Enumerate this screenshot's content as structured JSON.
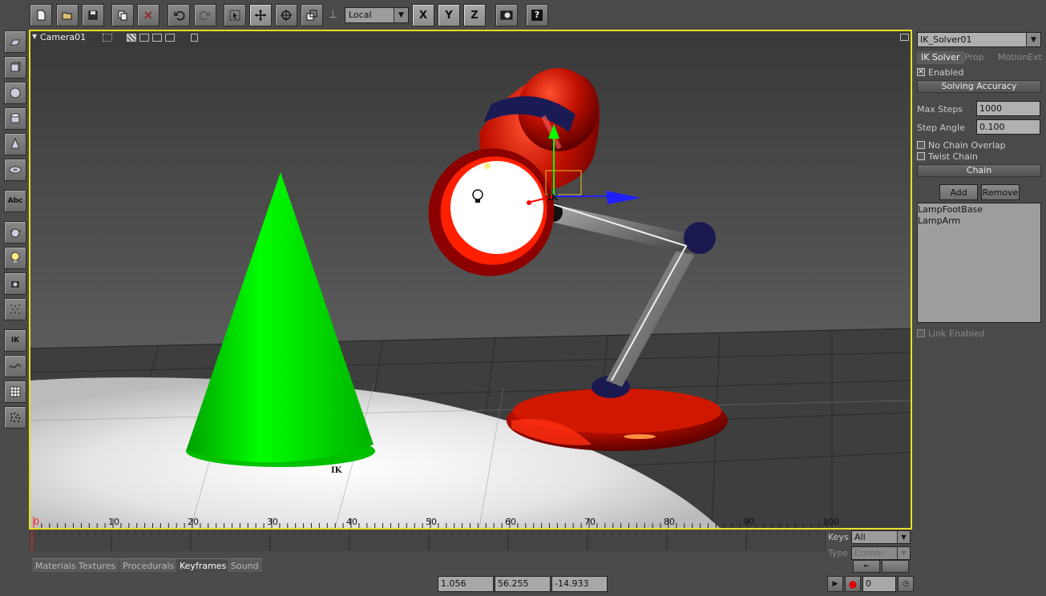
{
  "toolbar": {
    "buttons": [
      {
        "name": "new-file-icon",
        "glyph": "🗋"
      },
      {
        "name": "open-folder-icon",
        "glyph": "📂"
      },
      {
        "name": "save-icon",
        "glyph": "💾"
      },
      {
        "name": "copy-icon",
        "glyph": "⧉"
      },
      {
        "name": "delete-icon",
        "glyph": "✕"
      },
      {
        "name": "undo-icon",
        "glyph": "↶"
      },
      {
        "name": "redo-icon",
        "glyph": "↷"
      },
      {
        "name": "select-tool-icon",
        "glyph": "⬚"
      },
      {
        "name": "move-tool-icon",
        "glyph": "✥"
      },
      {
        "name": "rotate-tool-icon",
        "glyph": "⊕"
      },
      {
        "name": "scale-tool-icon",
        "glyph": "⧈"
      }
    ],
    "space_select": "Local",
    "axis_x": "X",
    "axis_y": "Y",
    "axis_z": "Z",
    "help": "?"
  },
  "left_tools": [
    {
      "name": "plane-icon",
      "label": ""
    },
    {
      "name": "cube-icon",
      "label": ""
    },
    {
      "name": "sphere-icon",
      "label": ""
    },
    {
      "name": "cylinder-icon",
      "label": ""
    },
    {
      "name": "cone-icon",
      "label": ""
    },
    {
      "name": "torus-icon",
      "label": ""
    },
    {
      "name": "text-tool-icon",
      "label": "Abc"
    },
    {
      "name": "teapot-icon",
      "label": ""
    },
    {
      "name": "light-icon",
      "label": ""
    },
    {
      "name": "camera-icon",
      "label": ""
    },
    {
      "name": "particles-icon",
      "label": ""
    },
    {
      "name": "ik-tool-icon",
      "label": "IK"
    },
    {
      "name": "curve-icon",
      "label": ""
    },
    {
      "name": "grid-icon",
      "label": ""
    },
    {
      "name": "noise-icon",
      "label": ""
    }
  ],
  "viewport": {
    "title": "Camera01",
    "ik_label_top": "IK",
    "ik_label_bottom": "IK",
    "ruler_ticks": [
      "0",
      "10",
      "20",
      "30",
      "40",
      "50",
      "60",
      "70",
      "80",
      "90",
      "100"
    ]
  },
  "keys_panel": {
    "keys_label": "Keys",
    "keys_value": "All",
    "type_label": "Type",
    "type_value": "Corner"
  },
  "bottom_tabs": [
    "Materials",
    "Textures",
    "Procedurals",
    "Keyframes",
    "Sound"
  ],
  "active_bottom_tab": "Keyframes",
  "coords": {
    "x": "1.056",
    "y": "56.255",
    "z": "-14.933"
  },
  "frame": "0",
  "right_panel": {
    "solver": "IK_Solver01",
    "tabs": [
      "IK Solver",
      "Prop",
      "Motion",
      "Ext"
    ],
    "enabled_label": "Enabled",
    "section_accuracy": "Solving Accuracy",
    "max_steps_label": "Max Steps",
    "max_steps_value": "1000",
    "step_angle_label": "Step Angle",
    "step_angle_value": "0.100",
    "no_chain_overlap_label": "No Chain Overlap",
    "twist_chain_label": "Twist Chain",
    "section_chain": "Chain",
    "add_label": "Add",
    "remove_label": "Remove",
    "chain_items": [
      "LampFootBase",
      "LampArm"
    ],
    "link_enabled_label": "Link Enabled"
  },
  "colors": {
    "viewport_border": "#e8e020",
    "cone": "#00e000",
    "lamp": "#c00000"
  }
}
